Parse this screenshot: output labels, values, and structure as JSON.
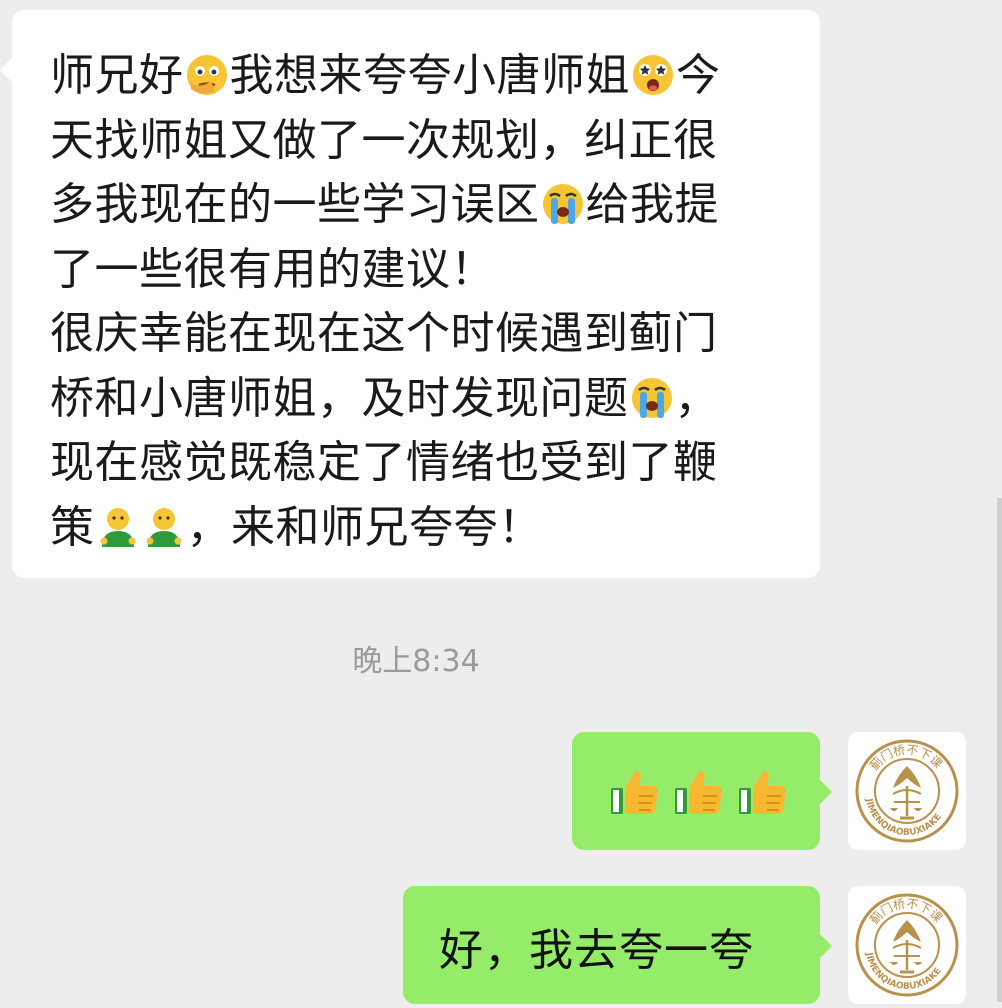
{
  "conversation": {
    "incoming_message": {
      "lines": [
        [
          {
            "t": "师兄好"
          },
          {
            "emoji": "thinking-face-icon"
          },
          {
            "t": "我想来夸夸小唐师姐"
          },
          {
            "emoji": "starstruck-face-icon"
          },
          {
            "t": "今"
          }
        ],
        [
          {
            "t": "天找师姐又做了一次规划，纠正很"
          }
        ],
        [
          {
            "t": "多我现在的一些学习误区"
          },
          {
            "emoji": "crying-face-icon"
          },
          {
            "t": "给我提"
          }
        ],
        [
          {
            "t": "了一些很有用的建议！"
          }
        ],
        [
          {
            "t": "很庆幸能在现在这个时候遇到蓟门"
          }
        ],
        [
          {
            "t": "桥和小唐师姐，及时发现问题"
          },
          {
            "emoji": "crying-face-icon"
          },
          {
            "t": "，"
          }
        ],
        [
          {
            "t": "现在感觉既稳定了情绪也受到了鞭"
          }
        ],
        [
          {
            "t": "策"
          },
          {
            "emoji": "person-green-shirt-icon"
          },
          {
            "emoji": "person-green-shirt-icon"
          },
          {
            "t": "，来和师兄夸夸！"
          }
        ]
      ]
    },
    "timestamp": "晚上8:34",
    "outgoing_messages": [
      {
        "type": "emoji",
        "emojis": [
          "thumbs-up-icon",
          "thumbs-up-icon",
          "thumbs-up-icon"
        ]
      },
      {
        "type": "text",
        "text": "好，我去夸一夸"
      }
    ],
    "avatar": {
      "name": "jimenqiao-logo",
      "logo_text_top": "蓟门桥不下课",
      "logo_text_bottom": "JIMENQIAOBUXIAKE",
      "accent_color": "#b8924a"
    }
  },
  "colors": {
    "background": "#ededed",
    "incoming_bubble": "#ffffff",
    "outgoing_bubble": "#95ec69",
    "timestamp_text": "#9a9a9a"
  }
}
